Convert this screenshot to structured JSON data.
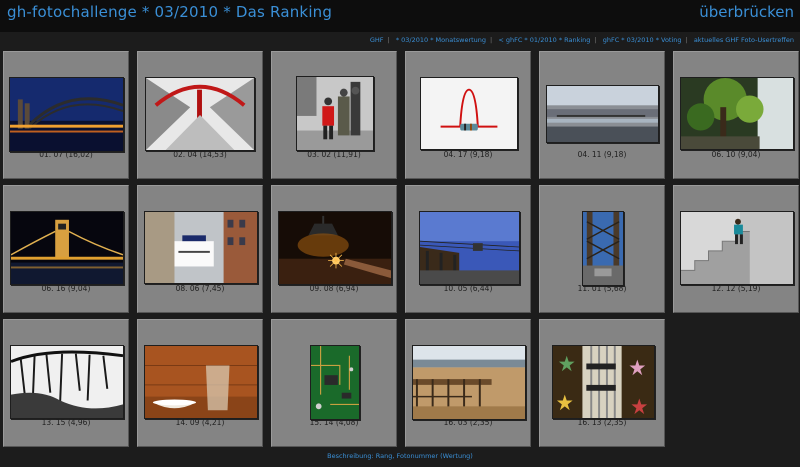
{
  "header": {
    "title": "gh-fotochallenge * 03/2010 * Das Ranking",
    "skip_label": "überbrücken"
  },
  "nav": {
    "separator": "|",
    "links": [
      "GHF",
      "* 03/2010 * Monatswertung",
      "< ghFC * 01/2010 * Ranking",
      "ghFC * 03/2010 * Voting",
      "aktuelles GHF Foto-Usertreffen"
    ]
  },
  "photos": [
    {
      "caption": "01. 07 (16,02)",
      "subject": "bridge-night-cathedral"
    },
    {
      "caption": "02. 04 (14,53)",
      "subject": "red-bridge-arch"
    },
    {
      "caption": "03. 02 (11,91)",
      "subject": "street-people-child"
    },
    {
      "caption": "04. 17 (9,18)",
      "subject": "red-wire-component"
    },
    {
      "caption": "04. 11 (9,18)",
      "subject": "city-river-panorama"
    },
    {
      "caption": "06. 10 (9,04)",
      "subject": "waterfall-tree"
    },
    {
      "caption": "06. 16 (9,04)",
      "subject": "chain-bridge-night"
    },
    {
      "caption": "08. 06 (7,45)",
      "subject": "sign-buildings"
    },
    {
      "caption": "09. 08 (6,94)",
      "subject": "lamp-sparkler"
    },
    {
      "caption": "10. 05 (6,44)",
      "subject": "gondola-cable"
    },
    {
      "caption": "11. 01 (5,68)",
      "subject": "tower-structure"
    },
    {
      "caption": "12. 12 (5,19)",
      "subject": "climber-stairs"
    },
    {
      "caption": "13. 15 (4,96)",
      "subject": "frozen-branches"
    },
    {
      "caption": "14. 09 (4,21)",
      "subject": "glass-bowl-wood"
    },
    {
      "caption": "15. 14 (4,08)",
      "subject": "circuit-board"
    },
    {
      "caption": "16. 03 (2,35)",
      "subject": "beach-pier"
    },
    {
      "caption": "16. 13 (2,35)",
      "subject": "guitar-stars"
    }
  ],
  "footer": {
    "text": "Beschreibung: Rang, Fotonummer (Wertung)"
  },
  "colors": {
    "accent": "#3a8fd6",
    "tile": "#848484",
    "background": "#1c1c1c"
  }
}
